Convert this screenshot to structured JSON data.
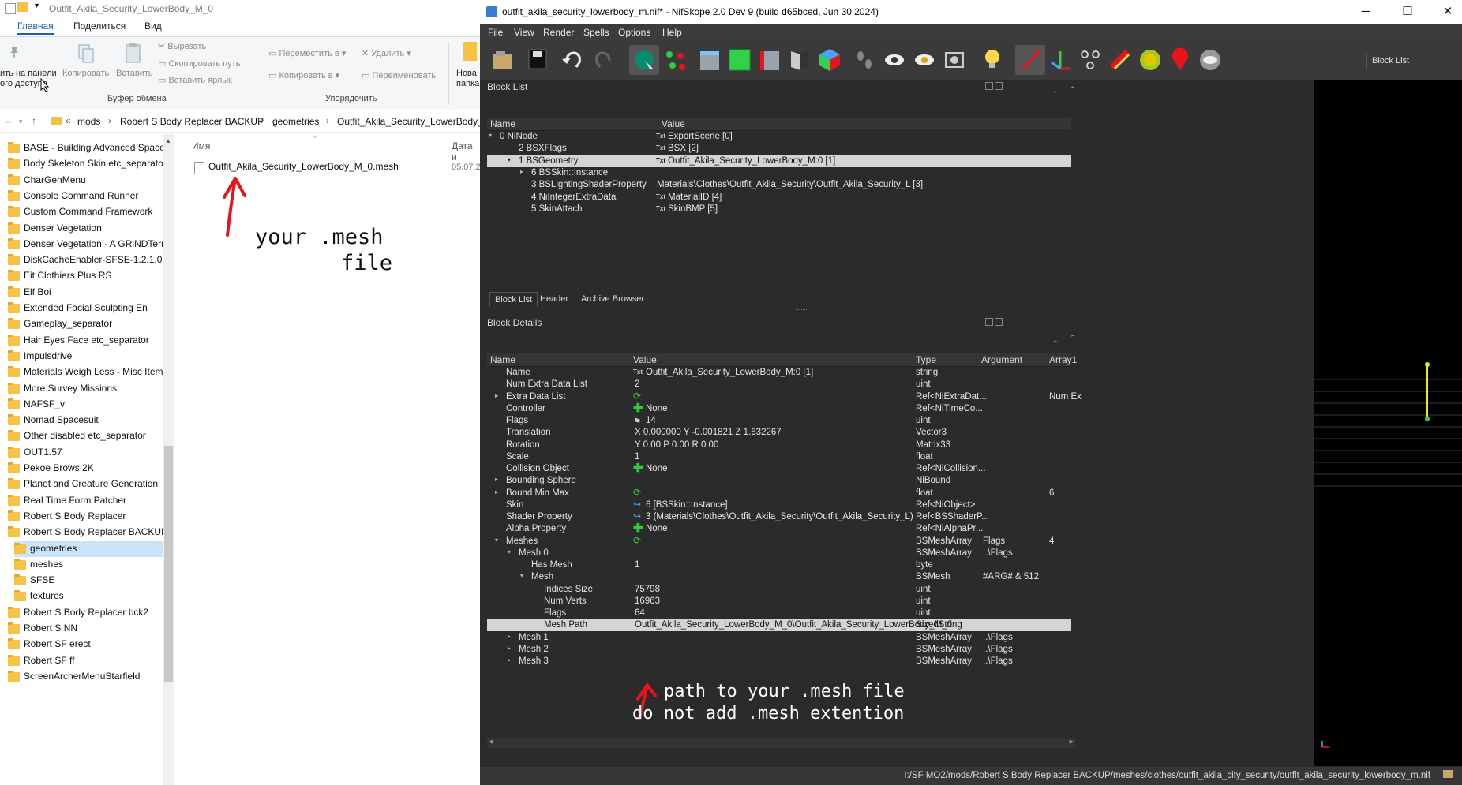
{
  "explorer": {
    "title": "Outfit_Akila_Security_LowerBody_M_0",
    "tabs": [
      "Главная",
      "Поделиться",
      "Вид"
    ],
    "ribbon": {
      "pin_label_1": "ить на панели",
      "pin_label_2": "ого доступа",
      "copy": "Копировать",
      "paste": "Вставить",
      "cut": "Вырезать",
      "copy_path": "Скопировать путь",
      "paste_shortcut": "Вставить ярлык",
      "clipboard_group": "Буфер обмена",
      "move_to": "Переместить в",
      "copy_to": "Копировать в",
      "delete": "Удалить",
      "rename": "Переименовать",
      "organize_group": "Упорядочить",
      "new_1": "Нова",
      "new_2": "папка"
    },
    "breadcrumb": [
      "mods",
      "Robert S Body Replacer BACKUP",
      "geometries",
      "Outfit_Akila_Security_LowerBody_"
    ],
    "tree": [
      "BASE - Building Advanced Space",
      "Body Skeleton Skin etc_separator",
      "CharGenMenu",
      "Console Command Runner",
      "Custom Command Framework",
      "Denser Vegetation",
      "Denser Vegetation - A GRiNDTerra",
      "DiskCacheEnabler-SFSE-1.2.1.0",
      "Eit Clothiers Plus RS",
      "Elf Boi",
      "Extended Facial Sculpting En",
      "Gameplay_separator",
      "Hair Eyes Face etc_separator",
      "Impulsdrive",
      "Materials Weigh Less - Misc Item",
      "More Survey Missions",
      "NAFSF_v",
      "Nomad Spacesuit",
      "Other disabled etc_separator",
      "OUT1.57",
      "Pekoe Brows 2K",
      "Planet and Creature Generation",
      "Real Time Form Patcher",
      "Robert S Body Replacer",
      "Robert S Body Replacer BACKUP",
      "geometries",
      "meshes",
      "SFSE",
      "textures",
      "Robert S Body Replacer bck2",
      "Robert S NN",
      "Robert SF erect",
      "Robert SF ff",
      "ScreenArcherMenuStarfield"
    ],
    "files_header": {
      "name": "Имя",
      "date": "Дата и"
    },
    "file_name": "Outfit_Akila_Security_LowerBody_M_0.mesh",
    "file_date": "05.07.2",
    "annotation_line1": "your .mesh",
    "annotation_line2": "file"
  },
  "nif": {
    "title": "outfit_akila_security_lowerbody_m.nif* - NifSkope 2.0 Dev 9 (build d65bced, Jun 30 2024)",
    "menu": [
      "File",
      "View",
      "Render",
      "Spells",
      "Options",
      "Help"
    ],
    "toolbar_blocklist": "Block List",
    "block_list": {
      "title": "Block List",
      "columns": [
        "Name",
        "Value"
      ],
      "rows": [
        {
          "name": "0 NiNode",
          "value": "ExportScene [0]"
        },
        {
          "name": "2 BSXFlags",
          "value": "BSX [2]"
        },
        {
          "name": "1 BSGeometry",
          "value": "Outfit_Akila_Security_LowerBody_M:0 [1]"
        },
        {
          "name": "6 BSSkin::Instance",
          "value": ""
        },
        {
          "name": "3 BSLightingShaderProperty",
          "value": "Materials\\Clothes\\Outfit_Akila_Security\\Outfit_Akila_Security_L [3]"
        },
        {
          "name": "4 NiIntegerExtraData",
          "value": "MaterialID [4]"
        },
        {
          "name": "5 SkinAttach",
          "value": "SkinBMP [5]"
        }
      ]
    },
    "tabs": [
      "Block List",
      "Header",
      "Archive Browser"
    ],
    "block_details": {
      "title": "Block Details",
      "columns": [
        "Name",
        "Value",
        "Type",
        "Argument",
        "Array1"
      ],
      "rows": [
        {
          "name": "Name",
          "value": "Outfit_Akila_Security_LowerBody_M:0 [1]",
          "type": "string",
          "arg": "",
          "arr": ""
        },
        {
          "name": "Num Extra Data List",
          "value": "2",
          "type": "uint",
          "arg": "",
          "arr": ""
        },
        {
          "name": "Extra Data List",
          "value": "",
          "type": "Ref<NiExtraDat...",
          "arg": "",
          "arr": "Num Ex"
        },
        {
          "name": "Controller",
          "value": "None",
          "type": "Ref<NiTimeCo...",
          "arg": "",
          "arr": ""
        },
        {
          "name": "Flags",
          "value": "14",
          "type": "uint",
          "arg": "",
          "arr": ""
        },
        {
          "name": "Translation",
          "value": "X 0.000000 Y -0.001821 Z 1.632267",
          "type": "Vector3",
          "arg": "",
          "arr": ""
        },
        {
          "name": "Rotation",
          "value": "Y 0.00 P 0.00 R 0.00",
          "type": "Matrix33",
          "arg": "",
          "arr": ""
        },
        {
          "name": "Scale",
          "value": "1",
          "type": "float",
          "arg": "",
          "arr": ""
        },
        {
          "name": "Collision Object",
          "value": "None",
          "type": "Ref<NiCollision...",
          "arg": "",
          "arr": ""
        },
        {
          "name": "Bounding Sphere",
          "value": "",
          "type": "NiBound",
          "arg": "",
          "arr": ""
        },
        {
          "name": "Bound Min Max",
          "value": "",
          "type": "float",
          "arg": "",
          "arr": "6"
        },
        {
          "name": "Skin",
          "value": "6 [BSSkin::Instance]",
          "type": "Ref<NiObject>",
          "arg": "",
          "arr": ""
        },
        {
          "name": "Shader Property",
          "value": "3 (Materials\\Clothes\\Outfit_Akila_Security\\Outfit_Akila_Security_L)",
          "type": "Ref<BSShaderP...",
          "arg": "",
          "arr": ""
        },
        {
          "name": "Alpha Property",
          "value": "None",
          "type": "Ref<NiAlphaPr...",
          "arg": "",
          "arr": ""
        },
        {
          "name": "Meshes",
          "value": "",
          "type": "BSMeshArray",
          "arg": "Flags",
          "arr": "4"
        },
        {
          "name": "Mesh 0",
          "value": "",
          "type": "BSMeshArray",
          "arg": "..\\Flags",
          "arr": ""
        },
        {
          "name": "Has Mesh",
          "value": "1",
          "type": "byte",
          "arg": "",
          "arr": ""
        },
        {
          "name": "Mesh",
          "value": "",
          "type": "BSMesh",
          "arg": "#ARG# & 512",
          "arr": ""
        },
        {
          "name": "Indices Size",
          "value": "75798",
          "type": "uint",
          "arg": "",
          "arr": ""
        },
        {
          "name": "Num Verts",
          "value": "16963",
          "type": "uint",
          "arg": "",
          "arr": ""
        },
        {
          "name": "Flags",
          "value": "64",
          "type": "uint",
          "arg": "",
          "arr": ""
        },
        {
          "name": "Mesh Path",
          "value": "Outfit_Akila_Security_LowerBody_M_0\\Outfit_Akila_Security_LowerBody_M_0",
          "type": "SizedString",
          "arg": "",
          "arr": ""
        },
        {
          "name": "Mesh 1",
          "value": "",
          "type": "BSMeshArray",
          "arg": "..\\Flags",
          "arr": ""
        },
        {
          "name": "Mesh 2",
          "value": "",
          "type": "BSMeshArray",
          "arg": "..\\Flags",
          "arr": ""
        },
        {
          "name": "Mesh 3",
          "value": "",
          "type": "BSMeshArray",
          "arg": "..\\Flags",
          "arr": ""
        }
      ]
    },
    "annotation_line1": "path to your .mesh file",
    "annotation_line2": "do not add .mesh extention",
    "status_path": "I:/SF MO2/mods/Robert S Body Replacer BACKUP/meshes/clothes/outfit_akila_city_security/outfit_akila_security_lowerbody_m.nif"
  },
  "colors": {
    "annotation_red": "#e8141c",
    "nif_bg": "#2b2b2b",
    "selected_row": "#d4d4d4"
  }
}
